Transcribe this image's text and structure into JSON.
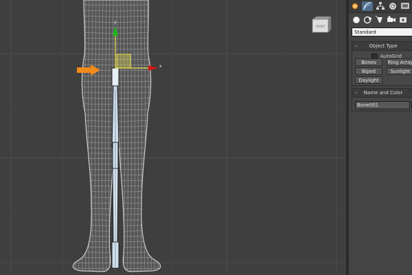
{
  "viewport": {
    "viewcube_label": "FRONT",
    "gizmo": {
      "x_label": "x",
      "y_label": "y"
    },
    "colors": {
      "background": "#3f3f3f",
      "grid": "#4e4e4e",
      "mesh": "#c8c8c8",
      "arrow": "#f28a1c",
      "gizmo_x": "#d01616",
      "gizmo_y": "#18b818",
      "gizmo_plane": "#e8e34a",
      "bone": "#d8e8f4"
    }
  },
  "command_panel": {
    "tabs": [
      {
        "icon": "sun-icon",
        "active": true
      },
      {
        "icon": "modify-arc-icon"
      },
      {
        "icon": "hierarchy-icon"
      },
      {
        "icon": "motion-icon"
      },
      {
        "icon": "display-icon"
      }
    ],
    "subtabs": [
      {
        "icon": "geometry-sphere-icon"
      },
      {
        "icon": "shapes-icon"
      },
      {
        "icon": "lights-icon"
      },
      {
        "icon": "cameras-icon"
      },
      {
        "icon": "helpers-icon"
      }
    ],
    "category_dropdown": "Standard",
    "object_type": {
      "title": "Object Type",
      "collapse_glyph": "-",
      "autogrid_label": "AutoGrid",
      "buttons": [
        "Bones",
        "Ring Array",
        "Biped",
        "Sunlight",
        "Daylight"
      ]
    },
    "name_and_color": {
      "title": "Name and Color",
      "collapse_glyph": "-",
      "name_value": "Bone001"
    }
  }
}
